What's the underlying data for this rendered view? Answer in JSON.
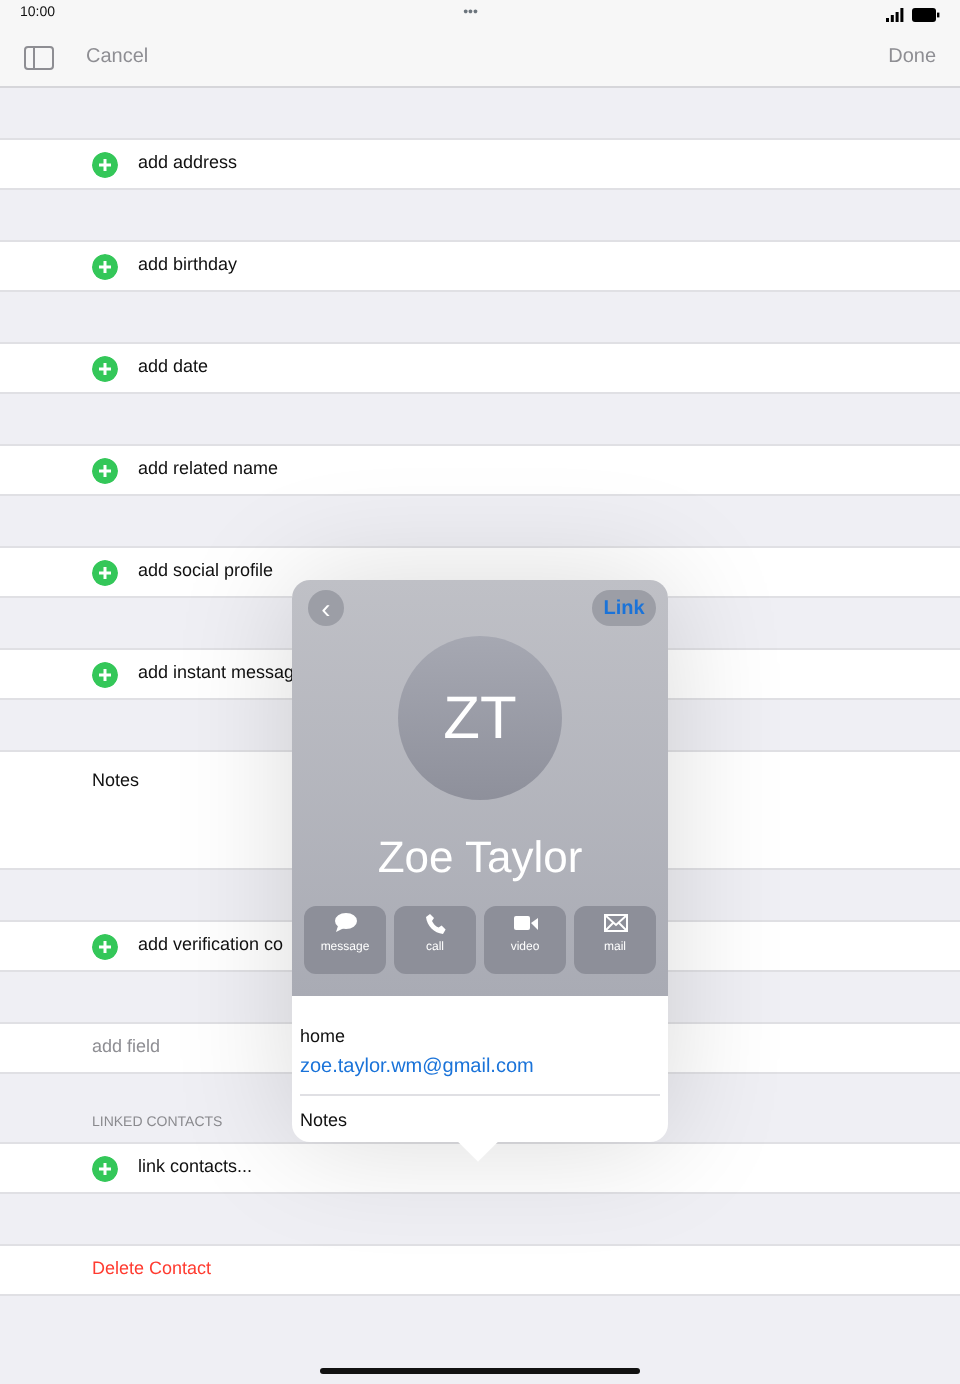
{
  "status_bar": {
    "time": "10:00",
    "dots": "•••"
  },
  "nav_bar": {
    "cancel": "Cancel",
    "done": "Done",
    "done_disabled": true
  },
  "rows": [
    {
      "kind": "add",
      "label": "add address"
    },
    {
      "kind": "add",
      "label": "add birthday"
    },
    {
      "kind": "add",
      "label": "add date"
    },
    {
      "kind": "add",
      "label": "add related name"
    },
    {
      "kind": "add",
      "label": "add social profile"
    },
    {
      "kind": "add",
      "label": "add instant messag"
    },
    {
      "kind": "notes",
      "label": "Notes"
    },
    {
      "kind": "add",
      "label": "add verification co"
    },
    {
      "kind": "plain",
      "label": "add field"
    },
    {
      "kind": "header",
      "label": "LINKED CONTACTS"
    },
    {
      "kind": "add",
      "label": "link contacts..."
    },
    {
      "kind": "delete",
      "label": "Delete Contact"
    }
  ],
  "popover": {
    "back": "‹",
    "link": "Link",
    "initials": "ZT",
    "name": "Zoe Taylor",
    "actions": [
      {
        "kind": "message",
        "label": "message"
      },
      {
        "kind": "call",
        "label": "call"
      },
      {
        "kind": "video",
        "label": "video"
      },
      {
        "kind": "mail",
        "label": "mail"
      }
    ],
    "email_label": "home",
    "email": "zoe.taylor.wm@gmail.com",
    "notes": "Notes"
  }
}
